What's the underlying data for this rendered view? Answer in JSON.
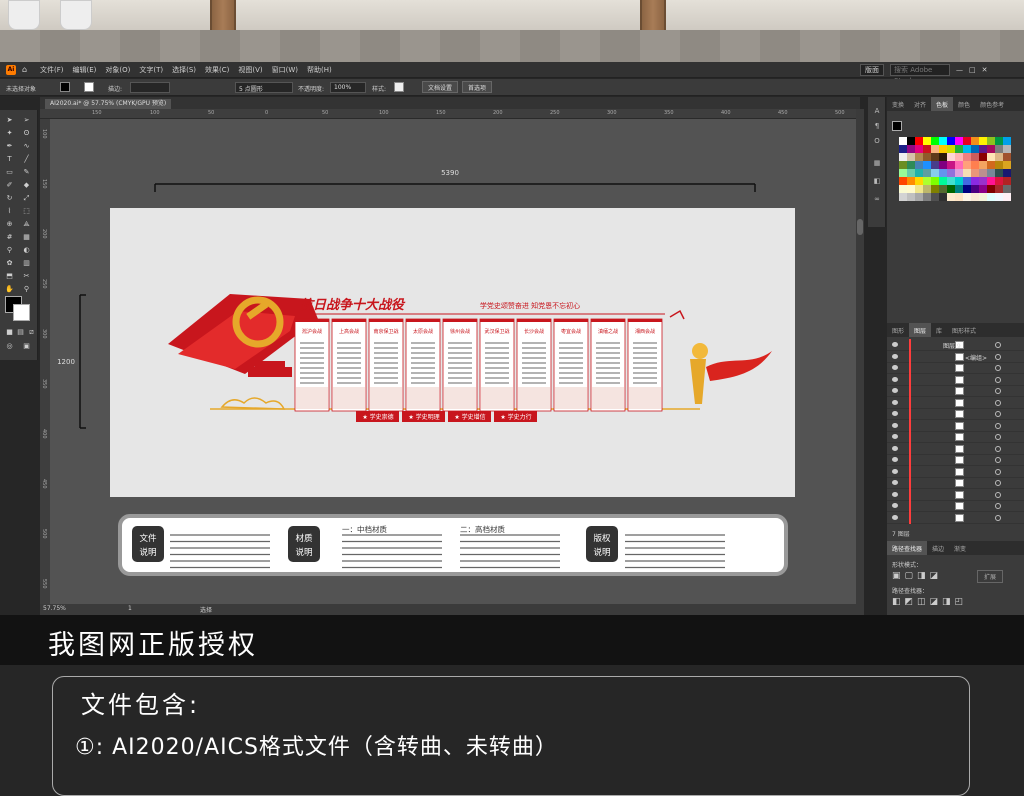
{
  "app": {
    "name": "Ai",
    "menu": [
      "文件(F)",
      "编辑(E)",
      "对象(O)",
      "文字(T)",
      "选择(S)",
      "效果(C)",
      "视图(V)",
      "窗口(W)",
      "帮助(H)"
    ],
    "workspace": "版面",
    "stock_placeholder": "搜索 Adobe Stock"
  },
  "control_bar": {
    "selection": "未选择对象",
    "stroke_label": "描边:",
    "brush_size": "5 点圆形",
    "opacity_label": "不透明度:",
    "opacity_value": "100%",
    "style_label": "样式:",
    "doc_setup": "文档设置",
    "prefs": "首选项"
  },
  "document": {
    "tab_title": "AI2020.ai* @ 57.75% (CMYK/GPU 预览)",
    "ruler_h": [
      "150",
      "100",
      "50",
      "0",
      "50",
      "100",
      "150",
      "200",
      "250",
      "300",
      "350",
      "400",
      "450",
      "500"
    ],
    "ruler_v": [
      "100",
      "150",
      "200",
      "250",
      "300",
      "350",
      "400",
      "450",
      "500",
      "550"
    ],
    "width_dim": "5390",
    "height_dim": "1200"
  },
  "design": {
    "title": "抗日战争十大战役",
    "slogan": "学党史颂赞奋进 知党恩不忘初心",
    "battles": [
      "淞沪会战",
      "上高会战",
      "南京保卫战",
      "太原会战",
      "徐州会战",
      "武汉保卫战",
      "长沙会战",
      "枣宜会战",
      "滇缅之战",
      "湘西会战"
    ],
    "buttons": [
      "学史崇德",
      "学史明理",
      "学史增信",
      "学史力行"
    ]
  },
  "notes": {
    "file_label": "文件\n说明",
    "material_label": "材质\n说明",
    "copyright_label": "版权\n说明",
    "mid_title": "一：中档材质",
    "high_title": "二：高档材质"
  },
  "status": {
    "zoom": "57.75%",
    "page": "1",
    "mode": "选择"
  },
  "panels": {
    "swatch_tabs": [
      "变换",
      "对齐",
      "色板",
      "颜色",
      "颜色参考"
    ],
    "layer_tabs": [
      "图形",
      "图层",
      "库",
      "图形样式"
    ],
    "layer_top": "图层 9",
    "layer_group": "<编组>",
    "layer_count": "7 图层",
    "path_tabs": [
      "路径查找器",
      "描边",
      "渐变"
    ],
    "shape_mode": "形状模式：",
    "path_finder": "路径查找器：",
    "expand": "扩展"
  },
  "footer": {
    "banner": "我图网正版授权",
    "includes": "文件包含:",
    "item1": "①: AI2020/AICS格式文件（含转曲、未转曲）"
  },
  "colors": {
    "party_red": "#c8161d",
    "gold": "#e6a82a",
    "ui_dark": "#3b3b3b"
  }
}
